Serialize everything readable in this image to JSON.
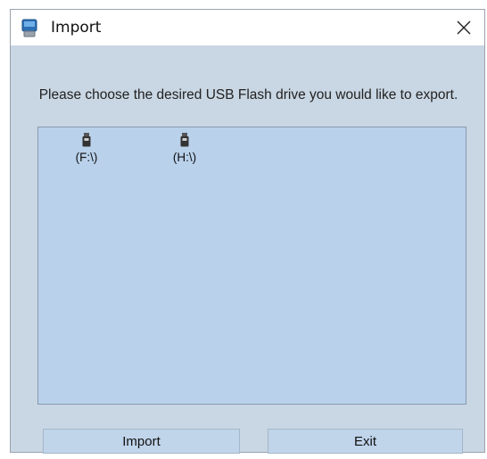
{
  "window": {
    "title": "Import",
    "title_icon": "app-icon",
    "close_symbol": "close-icon"
  },
  "prompt": "Please choose the desired USB Flash drive you would like to export.",
  "drives": [
    {
      "label": "(F:\\)",
      "icon": "usb-drive-icon"
    },
    {
      "label": "(H:\\)",
      "icon": "usb-drive-icon"
    }
  ],
  "buttons": {
    "import_label": "Import",
    "exit_label": "Exit"
  },
  "colors": {
    "window_bg": "#c9d6e3",
    "list_bg": "#b9d1ea",
    "button_bg": "#c0d4ea"
  }
}
